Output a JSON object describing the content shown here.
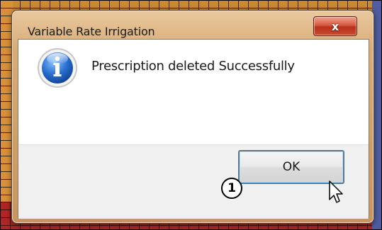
{
  "dialog": {
    "title": "Variable Rate Irrigation",
    "close_glyph": "x",
    "close_icon": "close-icon",
    "message_icon": "info-icon",
    "message": "Prescription deleted Successfully",
    "ok_label": "OK"
  },
  "annotation": {
    "callout_number": "1"
  },
  "colors": {
    "title_bar": "#d8ac77",
    "close_button": "#c84a33",
    "info_icon": "#1e5db7",
    "background_app": "#c98a34",
    "background_red": "#b32525"
  }
}
